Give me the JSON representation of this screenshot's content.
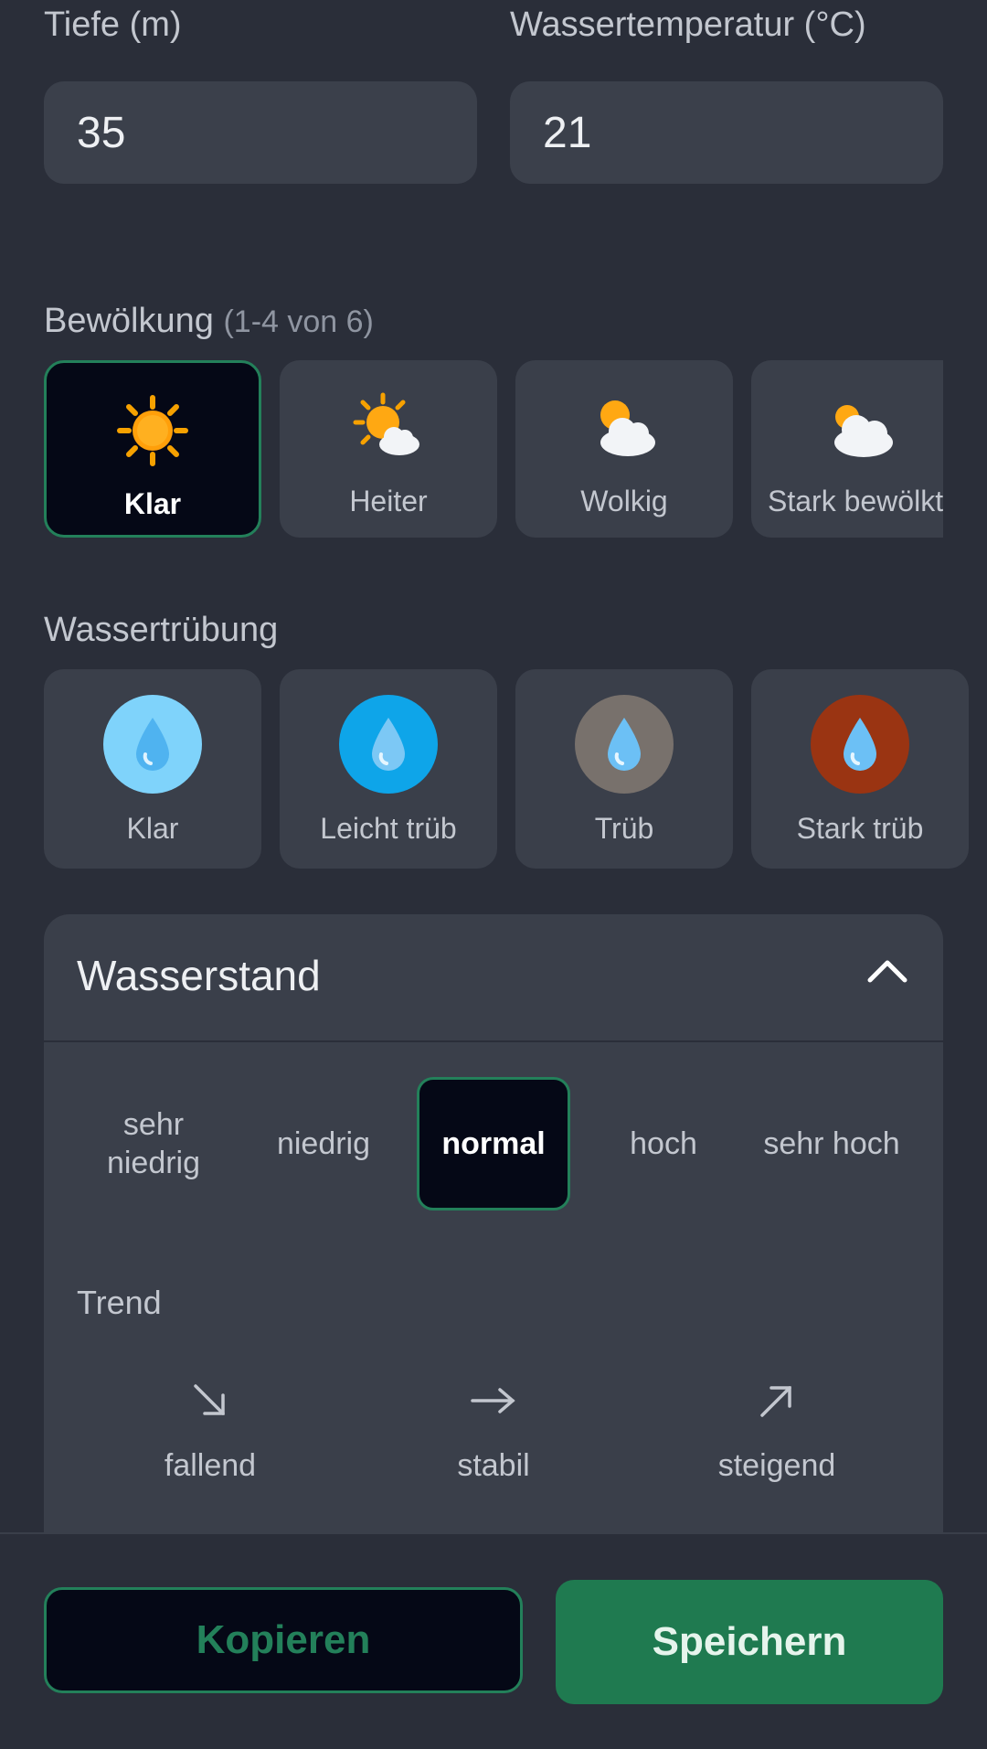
{
  "inputs": {
    "depth": {
      "label": "Tiefe (m)",
      "value": "35"
    },
    "water_temp": {
      "label": "Wassertemperatur (°C)",
      "value": "21"
    }
  },
  "clouds": {
    "title": "Bewölkung",
    "range_hint": "(1-4 von 6)",
    "items": [
      {
        "label": "Klar",
        "icon": "sun-icon",
        "selected": true
      },
      {
        "label": "Heiter",
        "icon": "sun-behind-small-cloud-icon",
        "selected": false
      },
      {
        "label": "Wolkig",
        "icon": "sun-behind-cloud-icon",
        "selected": false
      },
      {
        "label": "Stark bewölkt",
        "icon": "sun-behind-large-cloud-icon",
        "selected": false
      }
    ]
  },
  "turbidity": {
    "title": "Wassertrübung",
    "items": [
      {
        "label": "Klar",
        "icon": "droplet-icon",
        "color": "#7fd3fb"
      },
      {
        "label": "Leicht trüb",
        "icon": "droplet-icon",
        "color": "#0ea5e9"
      },
      {
        "label": "Trüb",
        "icon": "droplet-icon",
        "color": "#78716c"
      },
      {
        "label": "Stark trüb",
        "icon": "droplet-icon",
        "color": "#9a3412"
      }
    ]
  },
  "water_level": {
    "title": "Wasserstand",
    "levels": [
      "sehr niedrig",
      "niedrig",
      "normal",
      "hoch",
      "sehr hoch"
    ],
    "selected": "normal",
    "trend_title": "Trend",
    "trends": [
      {
        "label": "fallend",
        "icon": "arrow-down-right-icon"
      },
      {
        "label": "stabil",
        "icon": "arrow-right-icon"
      },
      {
        "label": "steigend",
        "icon": "arrow-up-right-icon"
      }
    ]
  },
  "footer": {
    "copy_label": "Kopieren",
    "save_label": "Speichern"
  },
  "colors": {
    "accent": "#23805a",
    "background": "#2a2e39",
    "card": "#3a3f4a"
  }
}
